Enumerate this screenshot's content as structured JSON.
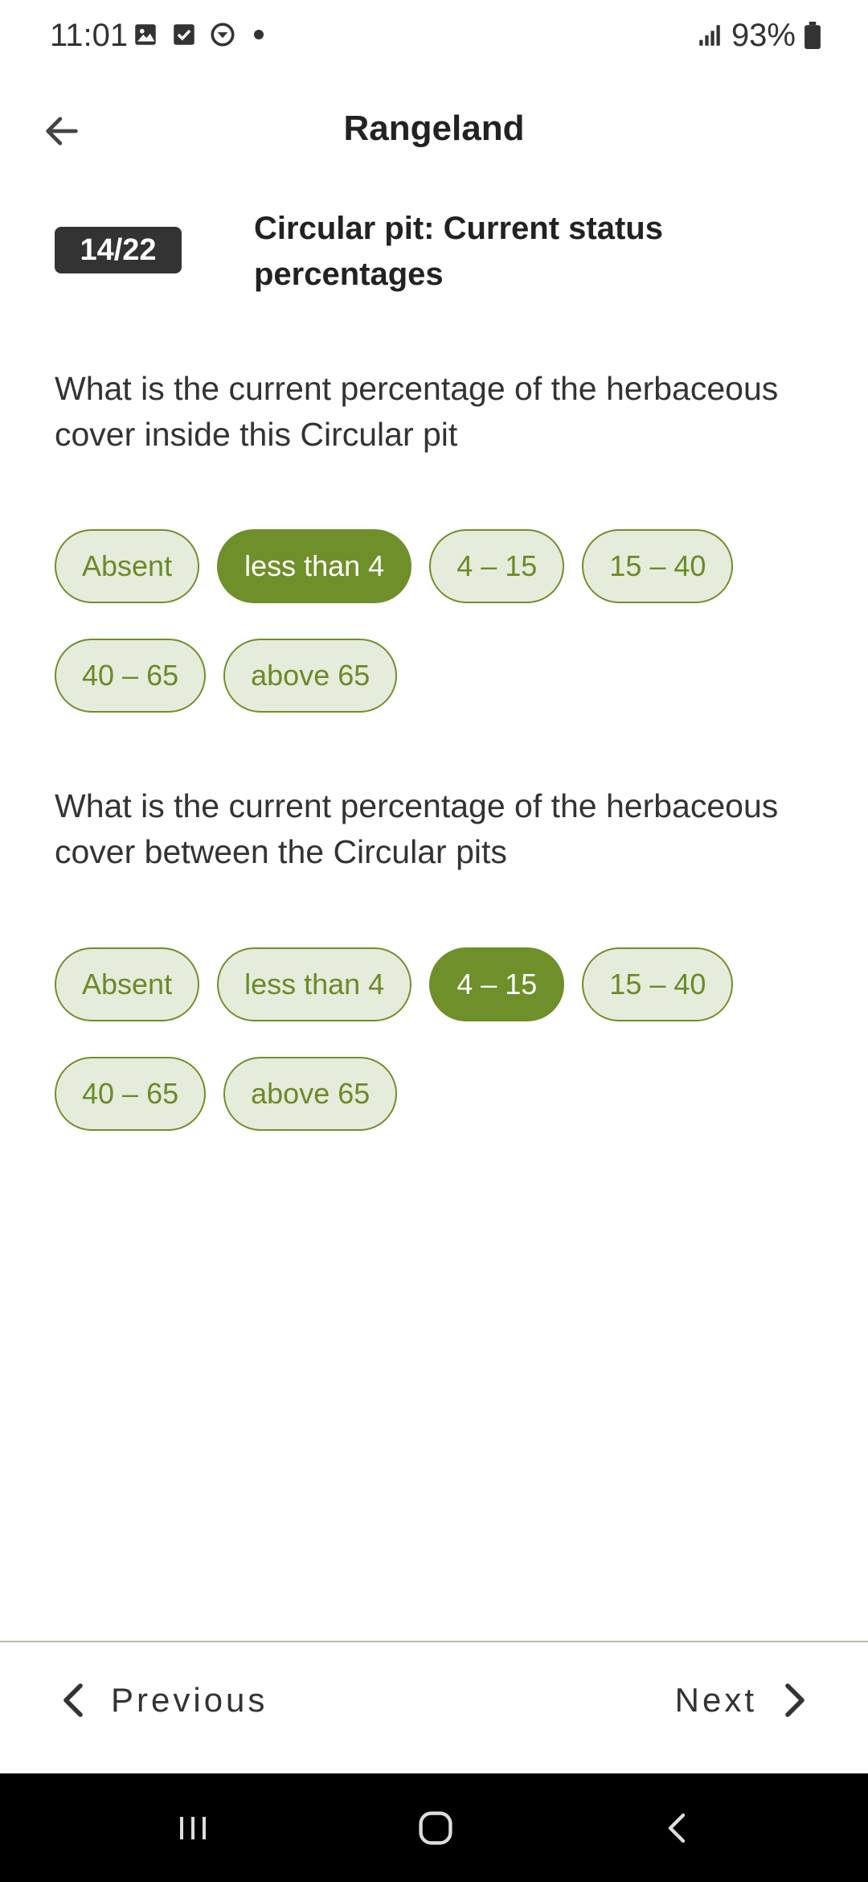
{
  "status_bar": {
    "time": "11:01",
    "battery": "93%",
    "icons": [
      "image-icon",
      "checkbox-icon",
      "app-notification-icon",
      "dot-icon",
      "signal-icon",
      "battery-icon"
    ]
  },
  "app_bar": {
    "title": "Rangeland",
    "back_icon": "arrow-left-icon"
  },
  "header": {
    "progress": "14/22",
    "section_title": "Circular pit: Current status percentages"
  },
  "questions": [
    {
      "text": "What is the current percentage of the herbaceous cover inside this Circular pit",
      "options": [
        "Absent",
        "less than 4",
        "4 – 15",
        "15 – 40",
        "40 – 65",
        "above 65"
      ],
      "selected": "less than 4"
    },
    {
      "text": "What is the current percentage of the herbaceous cover between the Circular pits",
      "options": [
        "Absent",
        "less than 4",
        "4 – 15",
        "15 – 40",
        "40 – 65",
        "above 65"
      ],
      "selected": "4 – 15"
    }
  ],
  "footer": {
    "previous_label": "Previous",
    "next_label": "Next"
  },
  "system_nav": {
    "buttons": [
      "recent-apps-icon",
      "home-icon",
      "back-icon"
    ]
  },
  "colors": {
    "accent": "#6f8f2a",
    "pill_background": "#e6ecdb",
    "badge_background": "#333333",
    "system_nav_background": "#000000"
  }
}
